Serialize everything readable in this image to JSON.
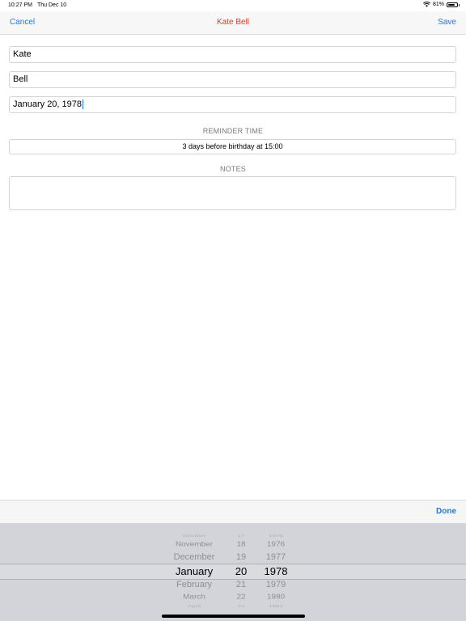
{
  "status_bar": {
    "time": "10:27 PM",
    "date": "Thu Dec 10",
    "battery_percent": "81%",
    "battery_level": 0.81
  },
  "nav": {
    "cancel_label": "Cancel",
    "title": "Kate Bell",
    "save_label": "Save"
  },
  "form": {
    "first_name": "Kate",
    "last_name": "Bell",
    "birthday": "January 20, 1978",
    "reminder_section_label": "REMINDER TIME",
    "reminder_value": "3 days before birthday at 15:00",
    "notes_section_label": "NOTES",
    "notes_value": ""
  },
  "toolbar": {
    "done_label": "Done"
  },
  "picker": {
    "months": [
      "October",
      "November",
      "December",
      "January",
      "February",
      "March",
      "April"
    ],
    "days": [
      "17",
      "18",
      "19",
      "20",
      "21",
      "22",
      "23"
    ],
    "years": [
      "1975",
      "1976",
      "1977",
      "1978",
      "1979",
      "1980",
      "1981"
    ]
  },
  "colors": {
    "accent": "#1f7ae0",
    "title": "#d4401f",
    "picker_bg": "#d2d4d9"
  }
}
